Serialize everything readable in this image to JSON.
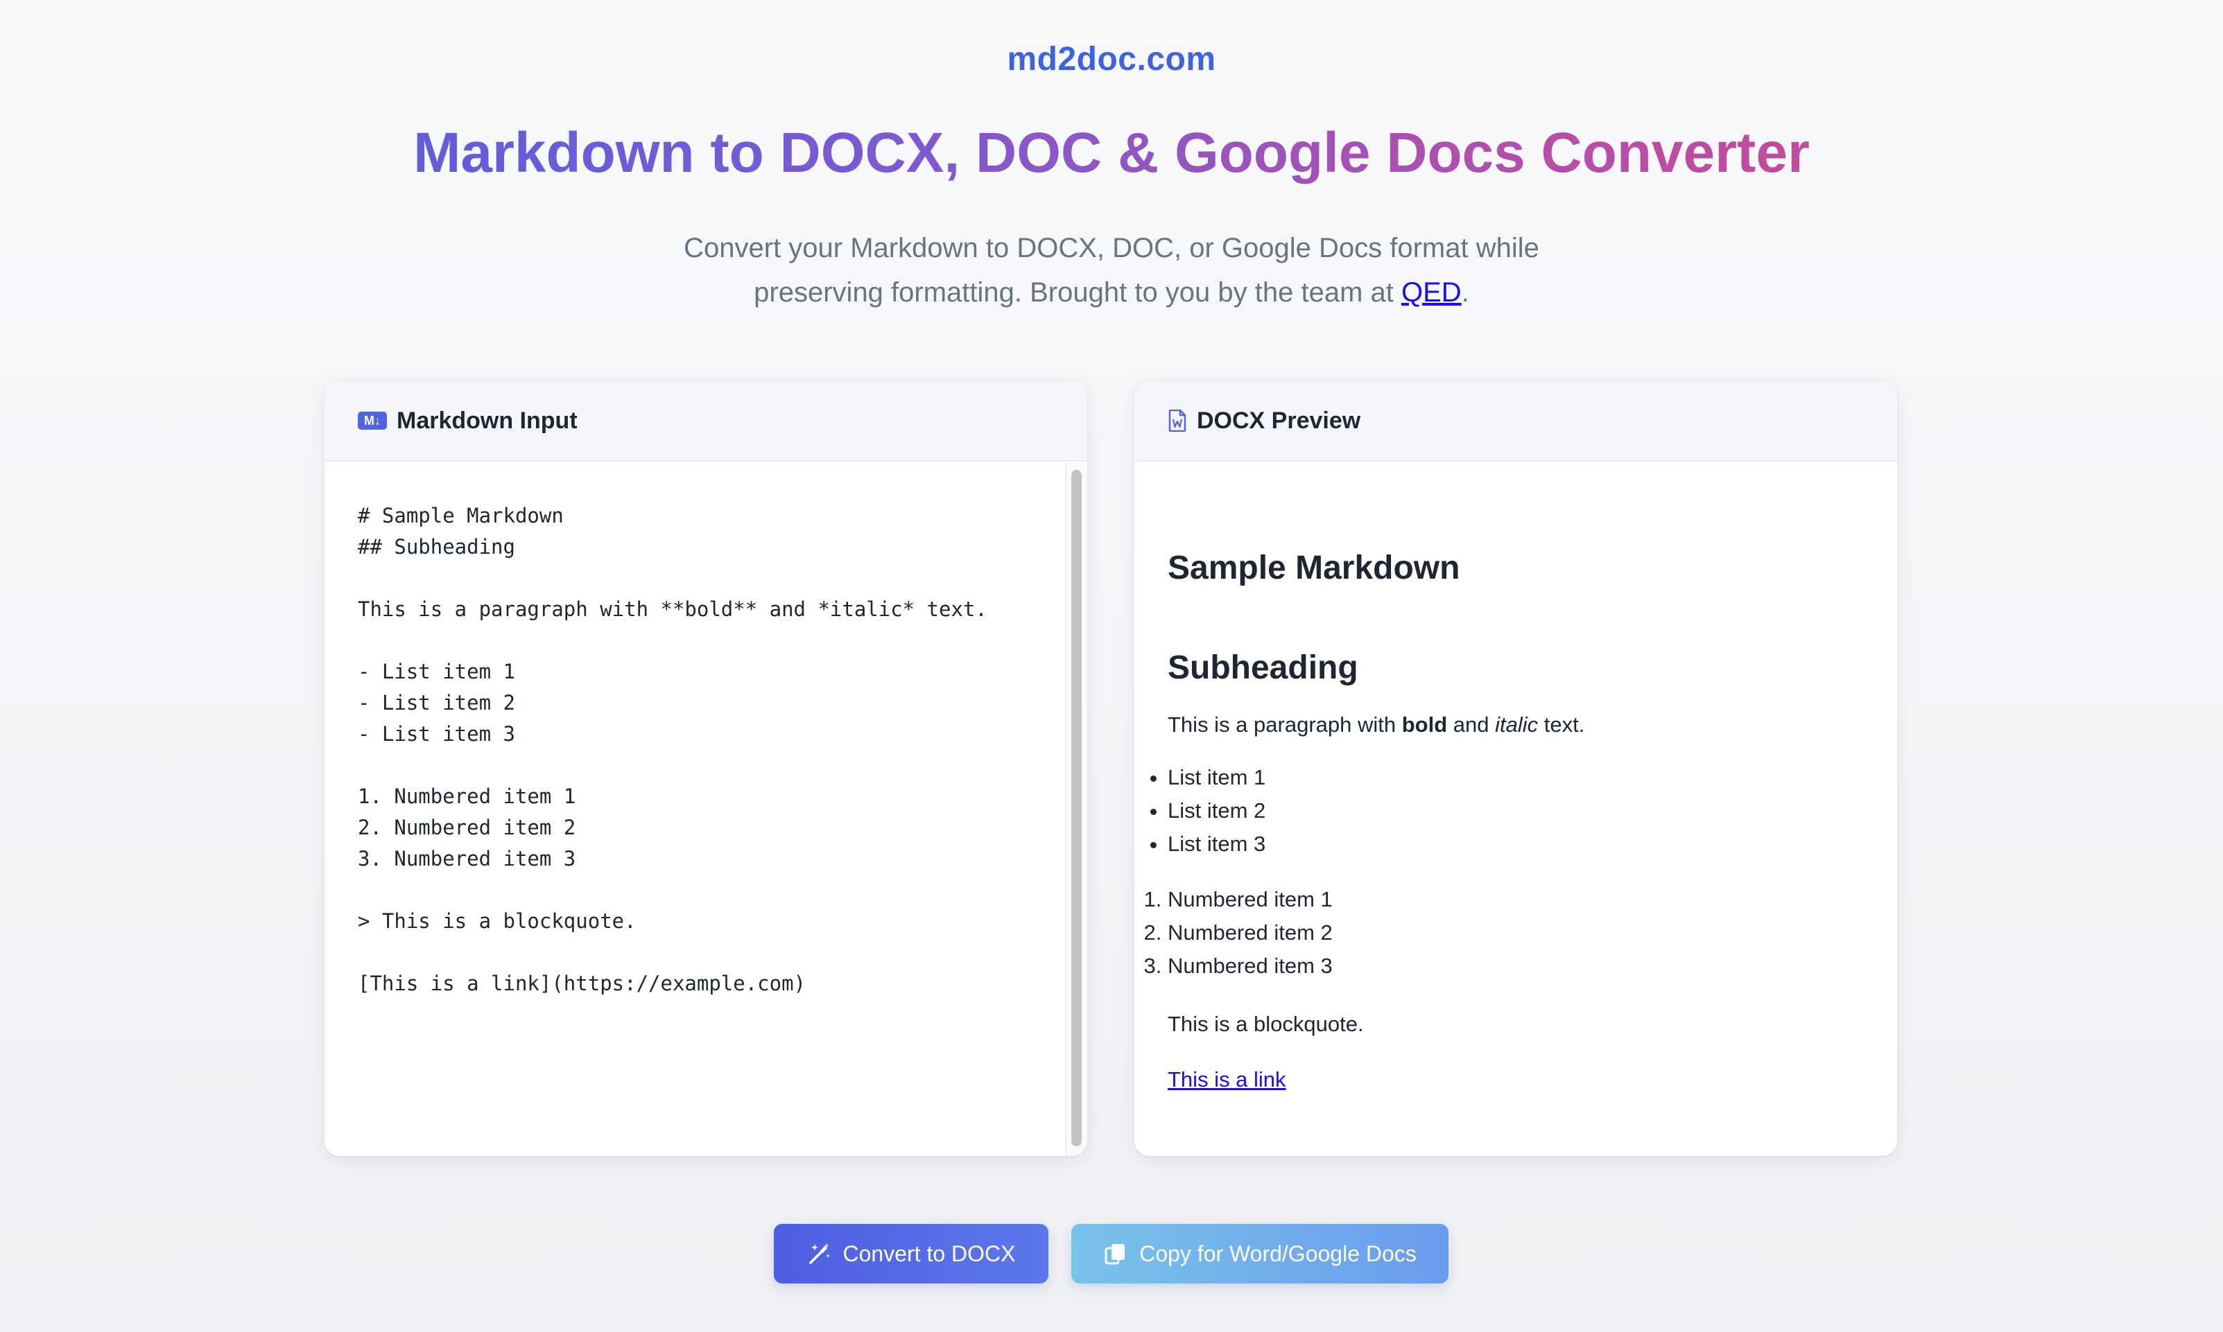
{
  "header": {
    "brand": "md2doc.com",
    "title": "Markdown to DOCX, DOC & Google Docs Converter",
    "subtitle_line1": "Convert your Markdown to DOCX, DOC, or Google Docs format while",
    "subtitle_line2_prefix": "preserving formatting. Brought to you by the team at ",
    "subtitle_link": "QED",
    "subtitle_line2_suffix": "."
  },
  "input_panel": {
    "icon": "markdown-icon",
    "icon_text": "M↓",
    "label": "Markdown Input",
    "content": "# Sample Markdown\n## Subheading\n\nThis is a paragraph with **bold** and *italic* text.\n\n- List item 1\n- List item 2\n- List item 3\n\n1. Numbered item 1\n2. Numbered item 2\n3. Numbered item 3\n\n> This is a blockquote.\n\n[This is a link](https://example.com)"
  },
  "preview_panel": {
    "icon": "word-document-icon",
    "label": "DOCX Preview",
    "heading1": "Sample Markdown",
    "heading2": "Subheading",
    "paragraph": {
      "prefix": "This is a paragraph with ",
      "bold": "bold",
      "middle": " and ",
      "italic": "italic",
      "suffix": " text."
    },
    "bullets": [
      "List item 1",
      "List item 2",
      "List item 3"
    ],
    "numbered": [
      "Numbered item 1",
      "Numbered item 2",
      "Numbered item 3"
    ],
    "blockquote": "This is a blockquote.",
    "link_text": "This is a link"
  },
  "actions": {
    "convert_label": "Convert to DOCX",
    "convert_icon": "magic-wand-icon",
    "copy_label": "Copy for Word/Google Docs",
    "copy_icon": "copy-icon"
  },
  "colors": {
    "brand": "#3f62e0",
    "convert_button": "#4d5ee2",
    "copy_button": "#79c2ea",
    "link": "#1a0dee"
  }
}
